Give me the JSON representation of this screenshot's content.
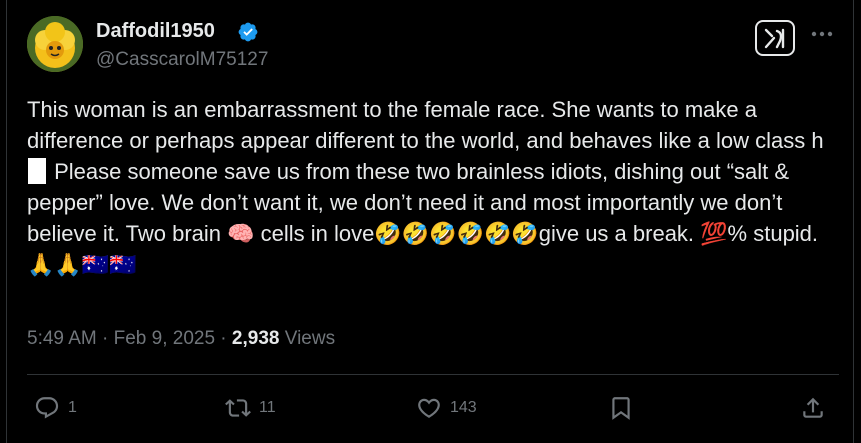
{
  "author": {
    "display_name": "Daffodil1950",
    "handle": "@CasscarolM75127",
    "verified": true
  },
  "post": {
    "line1": "This woman is an embarrassment to the female race. She wants to make a difference or perhaps appear different to the world, and behaves like a low class h",
    "line2": " Please someone save us from these two brainless idiots, dishing out “salt & pepper” love. We don’t want it, we don’t need it and most importantly we don’t believe it. Two brain 🧠 cells in love🤣🤣🤣🤣🤣🤣give us a break. 💯% stupid. 🙏🙏🇦🇺🇦🇺"
  },
  "meta": {
    "time": "5:49 AM",
    "sep1": " · ",
    "date": "Feb 9, 2025",
    "sep2": " · ",
    "views_count": "2,938",
    "views_label": " Views"
  },
  "actions": {
    "replies": "1",
    "reposts": "11",
    "likes": "143"
  },
  "colors": {
    "background": "#000000",
    "text": "#e7e9ea",
    "secondary": "#71767b",
    "verified": "#1d9bf0"
  },
  "icons": [
    "verified-badge-icon",
    "grok-icon",
    "more-icon",
    "reply-icon",
    "repost-icon",
    "like-icon",
    "bookmark-icon",
    "share-icon"
  ]
}
